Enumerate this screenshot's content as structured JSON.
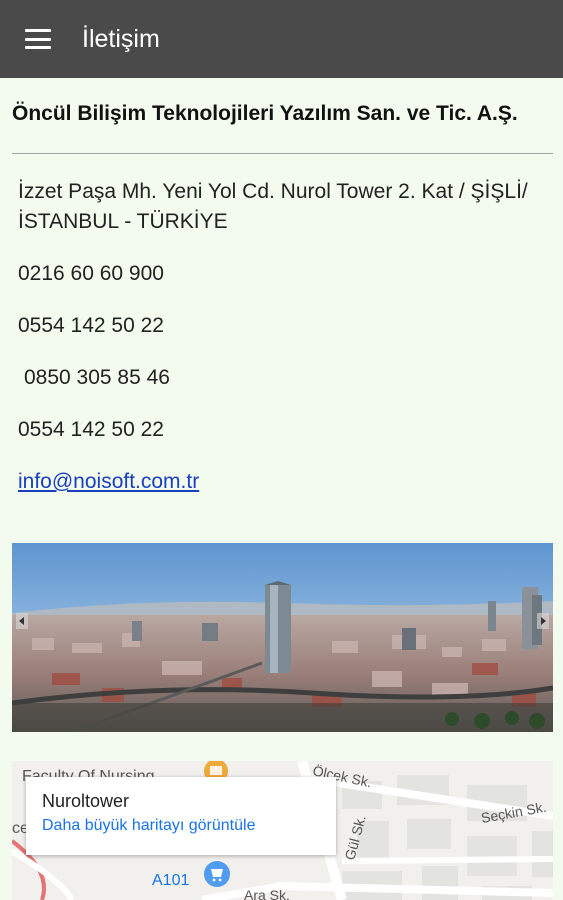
{
  "appbar": {
    "title": "İletişim",
    "menu_icon": "hamburger-menu-icon"
  },
  "contact": {
    "company": "Öncül Bilişim Teknolojileri Yazılım San. ve Tic. A.Ş.",
    "address": "İzzet Paşa Mh. Yeni Yol Cd. Nurol Tower 2. Kat / ŞİŞLİ/İSTANBUL - TÜRKİYE",
    "phones": [
      "0216 60 60 900",
      "0554 142 50 22",
      "0850 305 85 46",
      "0554 142 50 22"
    ],
    "email": "info@noisoft.com.tr"
  },
  "map": {
    "place_name": "Nuroltower",
    "larger_map_link": "Daha büyük haritayı görüntüle",
    "labels": {
      "faculty": "Faculty Of Nursing",
      "olcek": "Ölçek Sk.",
      "seckin": "Seçkin Sk.",
      "gul": "Gül Sk.",
      "a101": "A101",
      "ara": "Ara Sk."
    }
  },
  "colors": {
    "appbar": "#4a4a4a",
    "background": "#f3fbee",
    "link": "#1a3fbf",
    "map_link": "#1a73e8"
  }
}
